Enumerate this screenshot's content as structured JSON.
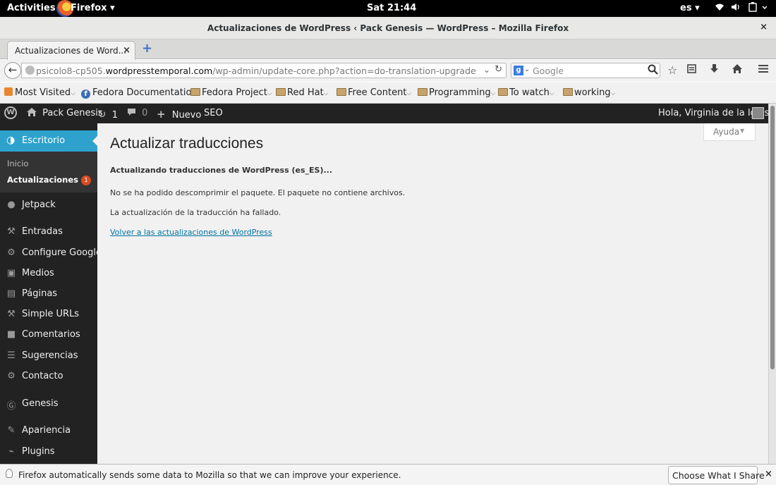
{
  "system_bar": {
    "activities": "Activities",
    "app": "Firefox ▾",
    "clock": "Sat 21:44",
    "lang": "es ▾"
  },
  "window": {
    "title": "Actualizaciones de WordPress ‹ Pack Genesis — WordPress – Mozilla Firefox",
    "close": "×"
  },
  "tabs": [
    {
      "label": "Actualizaciones de Word...",
      "close": "×"
    }
  ],
  "navbar": {
    "url_prefix": "psicolo8-cp505.",
    "url_domain": "wordpresstemporal.com",
    "url_path": "/wp-admin/update-core.php?action=do-translation-upgrade",
    "search_placeholder": "Google"
  },
  "bookmarks": [
    {
      "label": "Most Visited",
      "icon": "most-visited-icon"
    },
    {
      "label": "Fedora Documentation",
      "icon": "fedora-icon"
    },
    {
      "label": "Fedora Project",
      "icon": "folder-icon"
    },
    {
      "label": "Red Hat",
      "icon": "folder-icon"
    },
    {
      "label": "Free Content",
      "icon": "folder-icon"
    },
    {
      "label": "Programming",
      "icon": "folder-icon"
    },
    {
      "label": "To watch",
      "icon": "folder-icon"
    },
    {
      "label": "working",
      "icon": "folder-icon"
    }
  ],
  "adminbar": {
    "site": "Pack Genesis",
    "updates": "1",
    "comments": "0",
    "new": "Nuevo",
    "seo": "SEO",
    "greeting": "Hola, Virginia de la Iglesia"
  },
  "sidebar": {
    "active": "Escritorio",
    "sub_home": "Inicio",
    "sub_updates": "Actualizaciones",
    "updates_badge": "1",
    "items": [
      {
        "label": "Jetpack",
        "icon": "jetpack-icon"
      },
      {
        "label": "Entradas",
        "icon": "pin-icon"
      },
      {
        "label": "Configure Google",
        "icon": "gear-icon"
      },
      {
        "label": "Medios",
        "icon": "media-icon"
      },
      {
        "label": "Páginas",
        "icon": "pages-icon"
      },
      {
        "label": "Simple URLs",
        "icon": "pin-icon"
      },
      {
        "label": "Comentarios",
        "icon": "comment-icon"
      },
      {
        "label": "Sugerencias",
        "icon": "list-icon"
      },
      {
        "label": "Contacto",
        "icon": "gear-icon"
      },
      {
        "label": "Genesis",
        "icon": "genesis-icon"
      },
      {
        "label": "Apariencia",
        "icon": "brush-icon"
      },
      {
        "label": "Plugins",
        "icon": "plug-icon"
      }
    ]
  },
  "main": {
    "help": "Ayuda",
    "title": "Actualizar traducciones",
    "status": "Actualizando traducciones de WordPress (es_ES)...",
    "error1": "No se ha podido descomprimir el paquete. El paquete no contiene archivos.",
    "error2": "La actualización de la traducción ha fallado.",
    "back_link": "Volver a las actualizaciones de WordPress"
  },
  "notification": {
    "text": "Firefox automatically sends some data to Mozilla so that we can improve your experience.",
    "button": "Choose What I Share",
    "close": "×"
  }
}
